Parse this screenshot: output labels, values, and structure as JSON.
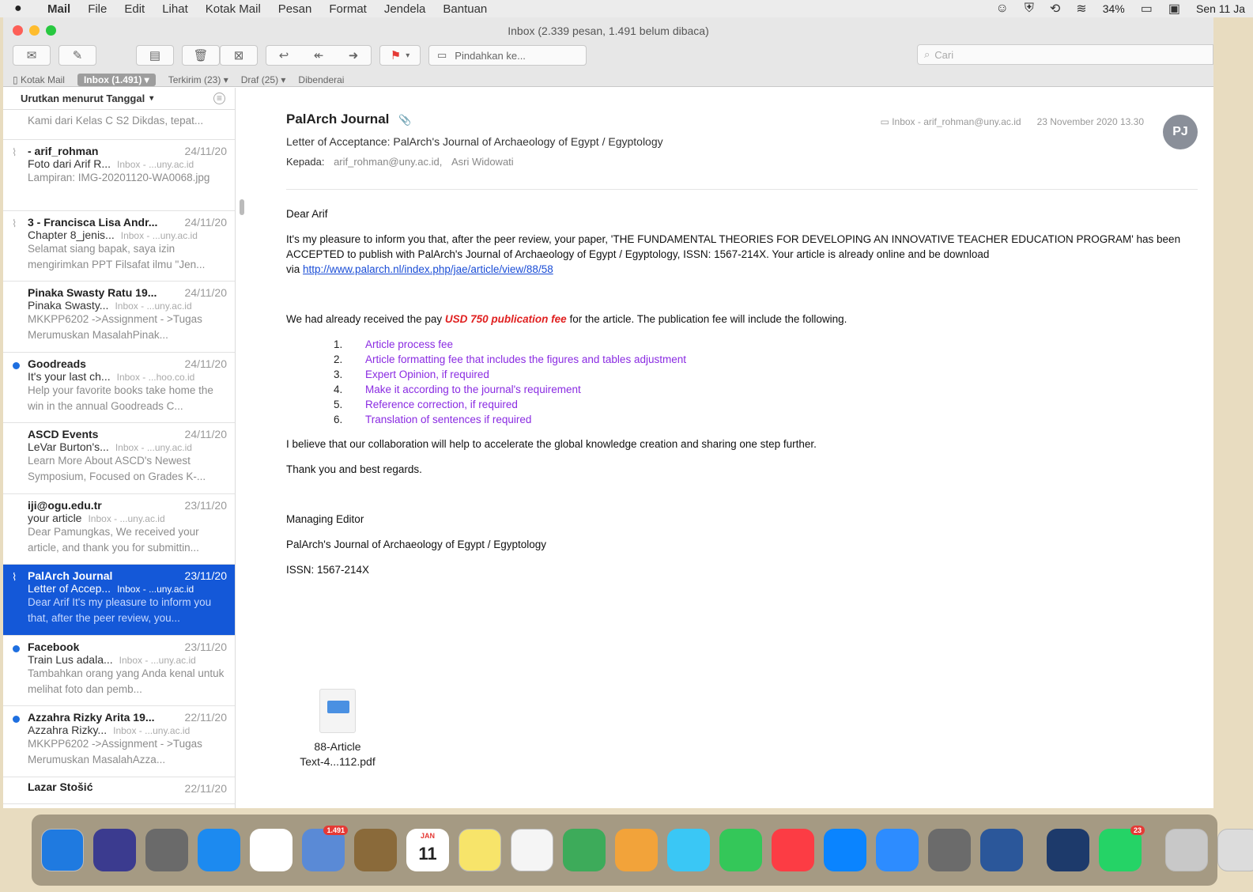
{
  "menubar": {
    "apple": "",
    "items": [
      "Mail",
      "File",
      "Edit",
      "Lihat",
      "Kotak Mail",
      "Pesan",
      "Format",
      "Jendela",
      "Bantuan"
    ],
    "battery": "34%",
    "clock": "Sen 11 Ja"
  },
  "window": {
    "title": "Inbox (2.339 pesan, 1.491 belum dibaca)",
    "toolbar": {
      "move_label": "Pindahkan ke...",
      "search_placeholder": "Cari"
    },
    "favorites": {
      "mailboxes": "Kotak Mail",
      "inbox": "Inbox (1.491)",
      "sent": "Terkirim (23)",
      "drafts": "Draf (25)",
      "flagged": "Dibenderai"
    }
  },
  "list": {
    "sort_label": "Urutkan menurut Tanggal",
    "partial_preview": "Kami dari Kelas C S2 Dikdas, tepat...",
    "messages": [
      {
        "from": "- arif_rohman",
        "date": "24/11/20",
        "subject": "Foto dari Arif R...",
        "mailbox": "Inbox - ...uny.ac.id",
        "preview": "Lampiran: IMG-20201120-WA0068.jpg",
        "unread": false,
        "attach": true
      },
      {
        "from": "3 - Francisca Lisa Andr...",
        "date": "24/11/20",
        "subject": "Chapter 8_jenis...",
        "mailbox": "Inbox - ...uny.ac.id",
        "preview": "Selamat siang bapak, saya izin mengirimkan PPT Filsafat ilmu \"Jen...",
        "unread": false,
        "attach": true
      },
      {
        "from": "Pinaka Swasty Ratu 19...",
        "date": "24/11/20",
        "subject": "Pinaka Swasty...",
        "mailbox": "Inbox - ...uny.ac.id",
        "preview": "MKKPP6202 ->Assignment - >Tugas Merumuskan MasalahPinak...",
        "unread": false,
        "attach": false
      },
      {
        "from": "Goodreads",
        "date": "24/11/20",
        "subject": "It's your last ch...",
        "mailbox": "Inbox - ...hoo.co.id",
        "preview": "Help your favorite books take home the win in the annual Goodreads C...",
        "unread": true,
        "attach": false
      },
      {
        "from": "ASCD Events",
        "date": "24/11/20",
        "subject": "LeVar Burton's...",
        "mailbox": "Inbox - ...uny.ac.id",
        "preview": "Learn More About ASCD's Newest Symposium, Focused on Grades K-...",
        "unread": false,
        "attach": false
      },
      {
        "from": "iji@ogu.edu.tr",
        "date": "23/11/20",
        "subject": "your article",
        "mailbox": "Inbox - ...uny.ac.id",
        "preview": "Dear Pamungkas, We received your article, and thank you for submittin...",
        "unread": false,
        "attach": false
      },
      {
        "from": "PalArch Journal",
        "date": "23/11/20",
        "subject": "Letter of Accep...",
        "mailbox": "Inbox - ...uny.ac.id",
        "preview": "Dear Arif It's my pleasure to inform you that, after the peer review, you...",
        "unread": false,
        "attach": true
      },
      {
        "from": "Facebook",
        "date": "23/11/20",
        "subject": "Train Lus adala...",
        "mailbox": "Inbox - ...uny.ac.id",
        "preview": "Tambahkan orang yang Anda kenal untuk melihat foto dan pemb...",
        "unread": true,
        "attach": false
      },
      {
        "from": "Azzahra Rizky Arita 19...",
        "date": "22/11/20",
        "subject": "Azzahra Rizky...",
        "mailbox": "Inbox - ...uny.ac.id",
        "preview": "MKKPP6202 ->Assignment - >Tugas Merumuskan MasalahAzza...",
        "unread": true,
        "attach": false
      }
    ],
    "last_from": "Lazar Stošić",
    "last_date": "22/11/20"
  },
  "reader": {
    "sender": "PalArch Journal",
    "subject": "Letter of Acceptance: PalArch's Journal of Archaeology of Egypt / Egyptology",
    "to_label": "Kepada:",
    "to": "arif_rohman@uny.ac.id,",
    "cc": "Asri Widowati",
    "mailbox": "Inbox - arif_rohman@uny.ac.id",
    "datetime": "23 November 2020 13.30",
    "avatar": "PJ",
    "greeting": "Dear Arif",
    "p1": "It's my pleasure to inform you that, after the peer review, your paper, 'THE FUNDAMENTAL THEORIES FOR DEVELOPING AN INNOVATIVE TEACHER EDUCATION PROGRAM' has been ACCEPTED to publish with PalArch's Journal of Archaeology of Egypt / Egyptology, ISSN: 1567-214X. Your article is already online and be download",
    "p1_via": "via",
    "link": "http://www.palarch.nl/index.php/jae/article/view/88/58",
    "p2_a": "We had already received the pay",
    "fee": "USD 750 publication fee",
    "p2_b": "for the article. The publication fee will include the following.",
    "items": [
      {
        "n": "1.",
        "t": "Article process fee"
      },
      {
        "n": "2.",
        "t": "Article formatting fee that includes the figures and tables adjustment"
      },
      {
        "n": "3.",
        "t": "Expert Opinion, if required"
      },
      {
        "n": "4.",
        "t": "Make it according to the journal's requirement"
      },
      {
        "n": "5.",
        "t": "Reference correction, if required"
      },
      {
        "n": "6.",
        "t": "Translation of sentences if required"
      }
    ],
    "p3": "I believe that our collaboration will help to accelerate the global knowledge creation and sharing one step further.",
    "p4": "Thank you and best regards.",
    "sig1": "Managing Editor",
    "sig2": "PalArch's Journal of Archaeology of Egypt / Egyptology",
    "sig3": "ISSN: 1567-214X",
    "attachment": {
      "line1": "88-Article",
      "line2": "Text-4...112.pdf"
    }
  },
  "dock": {
    "mail_badge": "1.491",
    "calendar_day": "11",
    "calendar_month": "JAN",
    "whatsapp_badge": "23",
    "colors": [
      "#1f7ae0",
      "#3b3b8f",
      "#6a6a6a",
      "#1c8af0",
      "#ffffff",
      "#5a8ad6",
      "#8a6a3a",
      "#ffffff",
      "#f7e46a",
      "#f5f5f5",
      "#3dab5a",
      "#f2a33a",
      "#3ac7f5",
      "#34c759",
      "#fc3c44",
      "#0a84ff",
      "#2d8cff",
      "#6b6b6b",
      "#2b579a",
      "#1d3a6b",
      "#25d366",
      "#c8c8c8",
      "#dcdcdc"
    ]
  }
}
